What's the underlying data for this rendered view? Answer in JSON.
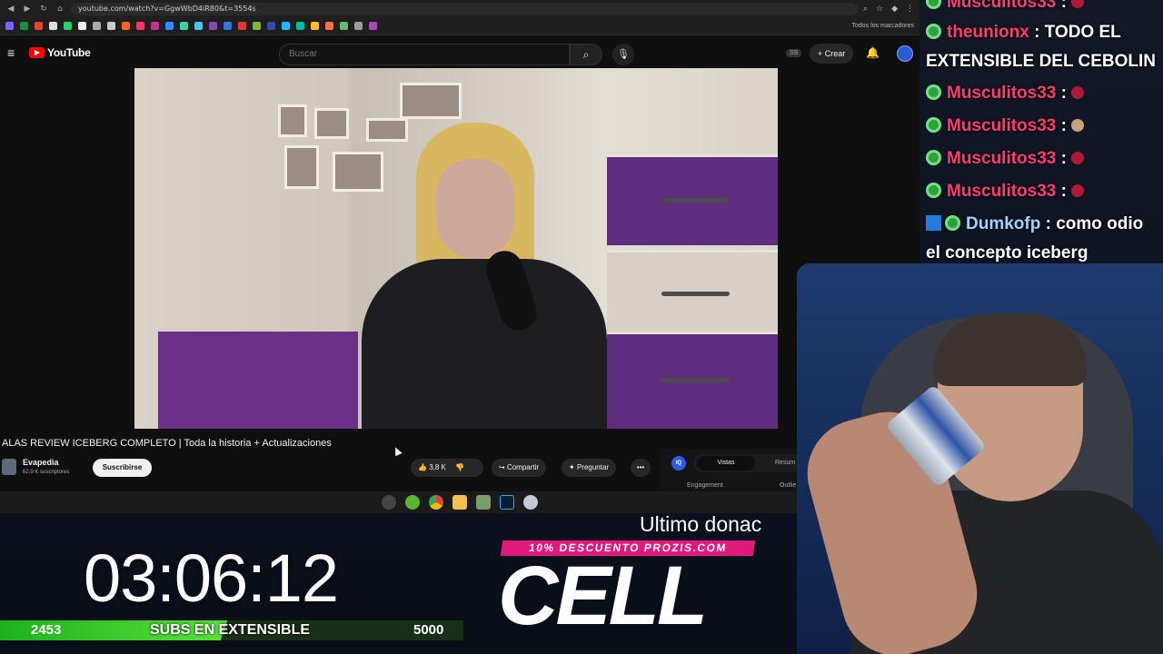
{
  "browser": {
    "url": "youtube.com/watch?v=GgwWbD4iR80&t=3554s",
    "bookmarks_all_label": "Todos los marcadores"
  },
  "youtube": {
    "logo_text": "YouTube",
    "search_placeholder": "Buscar",
    "search_icon": "search-icon",
    "mic_icon": "mic-icon",
    "ss_badge": "SS",
    "create_label": "+ Crear",
    "bell_icon": "bell-icon",
    "video_title": "ALAS REVIEW ICEBERG COMPLETO | Toda la historia + Actualizaciones",
    "channel_name": "Evapedia",
    "channel_subs": "62,9 K suscriptores",
    "subscribe_label": "Suscribirse",
    "like_count": "3,8 K",
    "share_label": "Compartir",
    "ask_label": "Preguntar",
    "more_label": "•••",
    "stats_badge": "IQ",
    "stats_tab_active": "Vistas",
    "stats_tab_2": "Resum",
    "stats_label_1": "Engagement",
    "stats_label_2": "Outlie"
  },
  "chat": {
    "messages": [
      {
        "user": "Musculitos33",
        "text": ":"
      },
      {
        "user": "theunionx",
        "text": ": TODO EL"
      },
      {
        "user": "",
        "text": "EXTENSIBLE DEL CEBOLIN"
      },
      {
        "user": "Musculitos33",
        "text": ":"
      },
      {
        "user": "Musculitos33",
        "text": ":"
      },
      {
        "user": "Musculitos33",
        "text": ":"
      },
      {
        "user": "Musculitos33",
        "text": ":"
      },
      {
        "user": "Dumkofp",
        "text": ": como odio"
      },
      {
        "user": "",
        "text": "el concepto iceberg"
      }
    ]
  },
  "overlay": {
    "timer": "03:06:12",
    "subs_current": "2453",
    "subs_label": "SUBS EN EXTENSIBLE",
    "subs_goal": "5000",
    "subs_progress": 0.4906,
    "last_donation_label": "Ultimo donac",
    "promo": "10% DESCUENTO PROZIS.COM",
    "donor_name": "CELL"
  },
  "colors": {
    "yt_red": "#ff0000",
    "chat_username": "#ff3d6e",
    "promo_pink": "#e0197a",
    "subs_green": "#3fcf2a"
  }
}
